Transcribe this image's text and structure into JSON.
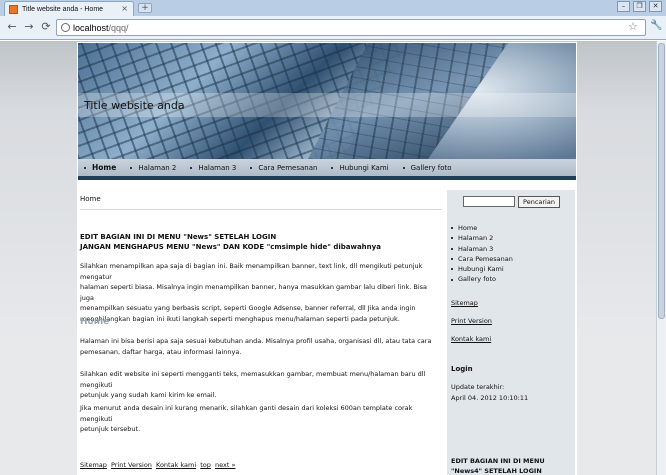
{
  "browser": {
    "tab_title": "Title website anda - Home",
    "tab_close": "×",
    "new_tab": "+",
    "window_buttons": [
      "–",
      "❐",
      "✕"
    ],
    "url_host": "localhost",
    "url_path": "/qqq/",
    "back_icon": "←",
    "forward_icon": "→",
    "reload_icon": "⟳",
    "star_icon": "☆",
    "wrench_icon": "🔧"
  },
  "site": {
    "title": "Title website anda",
    "menu": [
      "Home",
      "Halaman 2",
      "Halaman 3",
      "Cara Pemesanan",
      "Hubungi Kami",
      "Gallery foto"
    ],
    "breadcrumb": "Home",
    "notice_line1": "EDIT BAGIAN INI DI MENU \"News\" SETELAH LOGIN",
    "notice_line2": "JANGAN MENGHAPUS MENU \"News\" DAN KODE \"cmsimple hide\" dibawahnya",
    "p1_l1": "Silahkan menampilkan apa saja di bagian ini. Baik menampilkan banner, text link, dll mengikuti petunjuk mengatur",
    "p1_l2": "halaman seperti biasa. Misalnya ingin menampilkan banner, hanya masukkan gambar lalu diberi link. Bisa juga",
    "p1_l3": "menampilkan sesuatu yang berbasis script, seperti Google Adsense, banner referral, dll Jika anda ingin",
    "p1_l4": "menghilangkan bagian ini ikuti langkah seperti menghapus menu/halaman seperti pada petunjuk.",
    "section_heading": "Home",
    "p2_l1": "Halaman ini bisa berisi apa saja sesuai kebutuhan anda. Misalnya profil usaha, organisasi dll, atau tata cara",
    "p2_l2": "pemesanan, daftar harga, atau informasi lainnya.",
    "p3_l1": "Silahkan edit website ini seperti mengganti teks, memasukkan gambar, membuat menu/halaman baru dll mengikuti",
    "p3_l2": "petunjuk yang sudah kami kirim ke email.",
    "p4_l1": "Jika menurut anda desain ini kurang menarik, silahkan ganti desain dari koleksi 600an template corak mengikuti",
    "p4_l2": "petunjuk tersebut.",
    "footer": [
      "Sitemap",
      "Print Version",
      "Kontak kami",
      "top",
      "next »"
    ]
  },
  "sidebar": {
    "search_button": "Pencarian",
    "nav": [
      "Home",
      "Halaman 2",
      "Halaman 3",
      "Cara Pemesanan",
      "Hubungi Kami",
      "Gallery foto"
    ],
    "sitemap": "Sitemap",
    "print_version": "Print Version",
    "kontak": "Kontak kami",
    "login_heading": "Login",
    "update_label": "Update terakhir:",
    "update_date": "April 04. 2012 10:10:11",
    "edit_line1": "EDIT BAGIAN INI DI MENU",
    "edit_line2": "\"News4\" SETELAH LOGIN"
  }
}
